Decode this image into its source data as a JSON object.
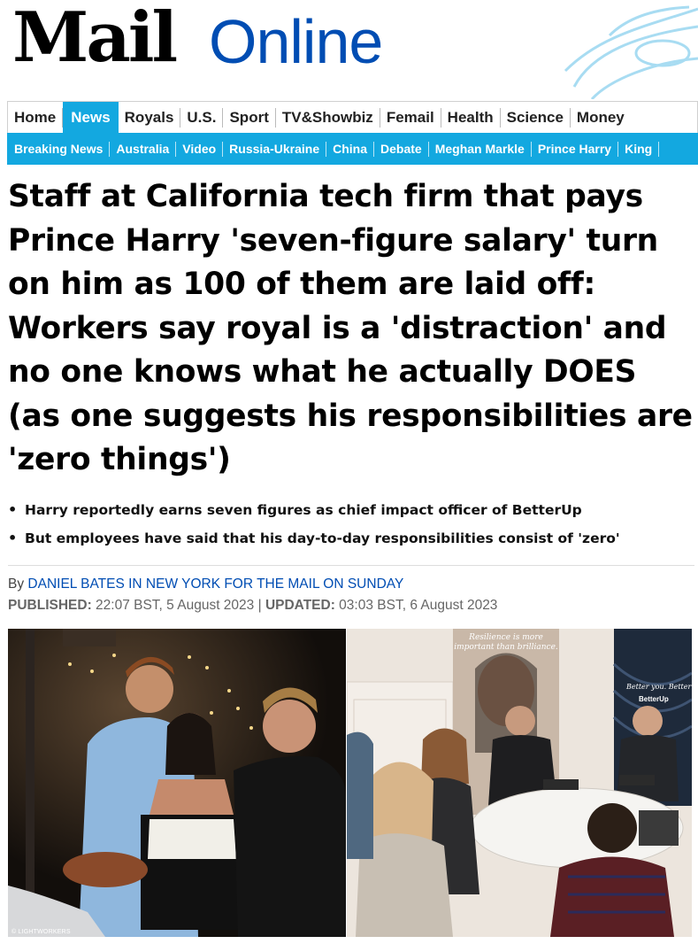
{
  "masthead": {
    "logo_mail": "Mail",
    "logo_online": "Online"
  },
  "nav_primary": [
    {
      "label": "Home",
      "active": false
    },
    {
      "label": "News",
      "active": true
    },
    {
      "label": "Royals",
      "active": false
    },
    {
      "label": "U.S.",
      "active": false
    },
    {
      "label": "Sport",
      "active": false
    },
    {
      "label": "TV&Showbiz",
      "active": false
    },
    {
      "label": "Femail",
      "active": false
    },
    {
      "label": "Health",
      "active": false
    },
    {
      "label": "Science",
      "active": false
    },
    {
      "label": "Money",
      "active": false
    }
  ],
  "nav_secondary": [
    "Breaking News",
    "Australia",
    "Video",
    "Russia-Ukraine",
    "China",
    "Debate",
    "Meghan Markle",
    "Prince Harry",
    "King"
  ],
  "article": {
    "headline": "Staff at California tech firm that pays Prince Harry 'seven-figure salary' turn on him as 100 of them are laid off: Workers say royal is a 'distraction' and no one knows what he actually DOES (as one suggests his responsibilities are 'zero things')",
    "bullets": [
      "Harry reportedly earns seven figures as chief impact officer of BetterUp",
      "But employees have said that his day-to-day responsibilities consist of 'zero'"
    ],
    "byline_prefix": "By ",
    "byline_author": "DANIEL BATES IN NEW YORK FOR THE MAIL ON SUNDAY",
    "published_label": "PUBLISHED:",
    "published_value": " 22:07 BST, 5 August 2023 | ",
    "updated_label": "UPDATED:",
    "updated_value": " 03:03 BST, 6 August 2023",
    "photo_left_credit": "© LIGHTWORKERS",
    "poster_text_1": "Resilience is more",
    "poster_text_2": "important than brilliance.",
    "banner_text_1": "Better you. Better",
    "banner_text_2": "BetterUp"
  },
  "colors": {
    "accent": "#13a8e0",
    "online_blue": "#004db3"
  },
  "icons": {
    "decor": "blue-swoosh-decor"
  }
}
